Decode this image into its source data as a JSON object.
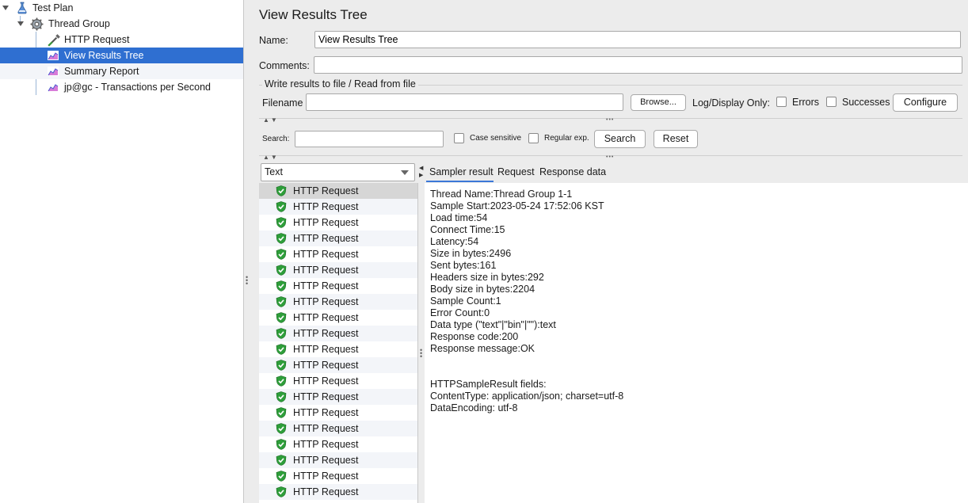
{
  "tree": {
    "items": [
      {
        "label": "Test Plan",
        "icon": "test-plan-icon"
      },
      {
        "label": "Thread Group",
        "icon": "gear-icon"
      },
      {
        "label": "HTTP Request",
        "icon": "pipette-icon"
      },
      {
        "label": "View Results Tree",
        "icon": "graph-icon"
      },
      {
        "label": "Summary Report",
        "icon": "graph-icon"
      },
      {
        "label": "jp@gc - Transactions per Second",
        "icon": "graph-icon"
      }
    ],
    "selected_color": "#2f6fd1"
  },
  "panel": {
    "title": "View Results Tree",
    "name_label": "Name:",
    "name_value": "View Results Tree",
    "comments_label": "Comments:",
    "comments_value": "",
    "file_group_title": "Write results to file / Read from file",
    "filename_label": "Filename",
    "filename_value": "",
    "browse_label": "Browse...",
    "log_display_label": "Log/Display Only:",
    "errors_label": "Errors",
    "successes_label": "Successes",
    "configure_label": "Configure"
  },
  "search": {
    "label": "Search:",
    "value": "",
    "case_sensitive_label": "Case sensitive",
    "regular_exp_label": "Regular exp.",
    "search_button": "Search",
    "reset_button": "Reset"
  },
  "renderer": {
    "selected": "Text"
  },
  "results": {
    "success_color": "#2e9e3a",
    "rows": [
      "HTTP Request",
      "HTTP Request",
      "HTTP Request",
      "HTTP Request",
      "HTTP Request",
      "HTTP Request",
      "HTTP Request",
      "HTTP Request",
      "HTTP Request",
      "HTTP Request",
      "HTTP Request",
      "HTTP Request",
      "HTTP Request",
      "HTTP Request",
      "HTTP Request",
      "HTTP Request",
      "HTTP Request",
      "HTTP Request",
      "HTTP Request",
      "HTTP Request"
    ]
  },
  "tabs": [
    "Sampler result",
    "Request",
    "Response data"
  ],
  "sampler_result": {
    "lines": [
      "Thread Name:Thread Group 1-1",
      "Sample Start:2023-05-24 17:52:06 KST",
      "Load time:54",
      "Connect Time:15",
      "Latency:54",
      "Size in bytes:2496",
      "Sent bytes:161",
      "Headers size in bytes:292",
      "Body size in bytes:2204",
      "Sample Count:1",
      "Error Count:0",
      "Data type (\"text\"|\"bin\"|\"\"):text",
      "Response code:200",
      "Response message:OK",
      "",
      "",
      "HTTPSampleResult fields:",
      "ContentType: application/json; charset=utf-8",
      "DataEncoding: utf-8"
    ]
  }
}
